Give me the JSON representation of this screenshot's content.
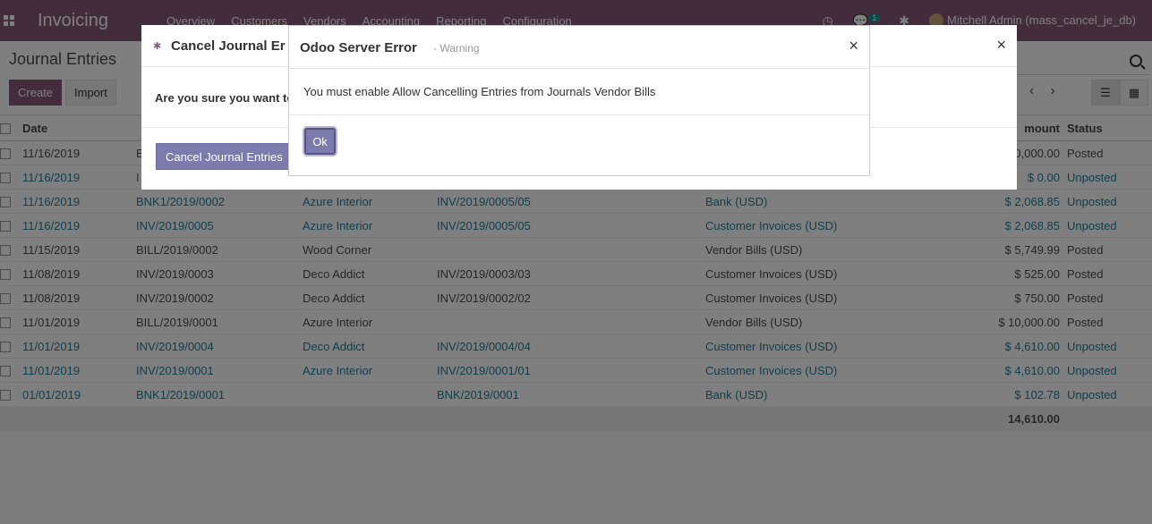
{
  "navbar": {
    "app_name": "Invoicing",
    "menu": [
      "Overview",
      "Customers",
      "Vendors",
      "Accounting",
      "Reporting",
      "Configuration"
    ],
    "chat_count": "1",
    "user": "Mitchell Admin (mass_cancel_je_db)"
  },
  "control": {
    "breadcrumb": "Journal Entries",
    "create_label": "Create",
    "import_label": "Import"
  },
  "list": {
    "headers": {
      "date": "Date",
      "amount": "mount",
      "status": "Status"
    },
    "rows": [
      {
        "date": "11/16/2019",
        "number": "B",
        "partner": "",
        "ref": "",
        "journal": "",
        "amount": "0,000.00",
        "status": "Posted",
        "blue": false
      },
      {
        "date": "11/16/2019",
        "number": "I",
        "partner": "",
        "ref": "",
        "journal": "",
        "amount": "$ 0.00",
        "status": "Unposted",
        "blue": true
      },
      {
        "date": "11/16/2019",
        "number": "BNK1/2019/0002",
        "partner": "Azure Interior",
        "ref": "INV/2019/0005/05",
        "journal": "Bank (USD)",
        "amount": "$ 2,068.85",
        "status": "Unposted",
        "blue": true
      },
      {
        "date": "11/16/2019",
        "number": "INV/2019/0005",
        "partner": "Azure Interior",
        "ref": "INV/2019/0005/05",
        "journal": "Customer Invoices (USD)",
        "amount": "$ 2,068.85",
        "status": "Unposted",
        "blue": true
      },
      {
        "date": "11/15/2019",
        "number": "BILL/2019/0002",
        "partner": "Wood Corner",
        "ref": "",
        "journal": "Vendor Bills (USD)",
        "amount": "$ 5,749.99",
        "status": "Posted",
        "blue": false
      },
      {
        "date": "11/08/2019",
        "number": "INV/2019/0003",
        "partner": "Deco Addict",
        "ref": "INV/2019/0003/03",
        "journal": "Customer Invoices (USD)",
        "amount": "$ 525.00",
        "status": "Posted",
        "blue": false
      },
      {
        "date": "11/08/2019",
        "number": "INV/2019/0002",
        "partner": "Deco Addict",
        "ref": "INV/2019/0002/02",
        "journal": "Customer Invoices (USD)",
        "amount": "$ 750.00",
        "status": "Posted",
        "blue": false
      },
      {
        "date": "11/01/2019",
        "number": "BILL/2019/0001",
        "partner": "Azure Interior",
        "ref": "",
        "journal": "Vendor Bills (USD)",
        "amount": "$ 10,000.00",
        "status": "Posted",
        "blue": false
      },
      {
        "date": "11/01/2019",
        "number": "INV/2019/0004",
        "partner": "Deco Addict",
        "ref": "INV/2019/0004/04",
        "journal": "Customer Invoices (USD)",
        "amount": "$ 4,610.00",
        "status": "Unposted",
        "blue": true
      },
      {
        "date": "11/01/2019",
        "number": "INV/2019/0001",
        "partner": "Azure Interior",
        "ref": "INV/2019/0001/01",
        "journal": "Customer Invoices (USD)",
        "amount": "$ 4,610.00",
        "status": "Unposted",
        "blue": true
      },
      {
        "date": "01/01/2019",
        "number": "BNK1/2019/0001",
        "partner": "",
        "ref": "BNK/2019/0001",
        "journal": "Bank (USD)",
        "amount": "$ 102.78",
        "status": "Unposted",
        "blue": true
      }
    ],
    "total": "14,610.00"
  },
  "back_modal": {
    "title": "Cancel Journal Er",
    "text": "Are you sure you want to",
    "button": "Cancel Journal Entries"
  },
  "error_modal": {
    "title": "Odoo Server Error",
    "subtitle": "- Warning",
    "message": "You must enable Allow Cancelling Entries from Journals Vendor Bills",
    "ok": "Ok"
  },
  "colors": {
    "brand": "#875a7b",
    "link": "#1f7f9a",
    "button": "#7c7bad"
  }
}
